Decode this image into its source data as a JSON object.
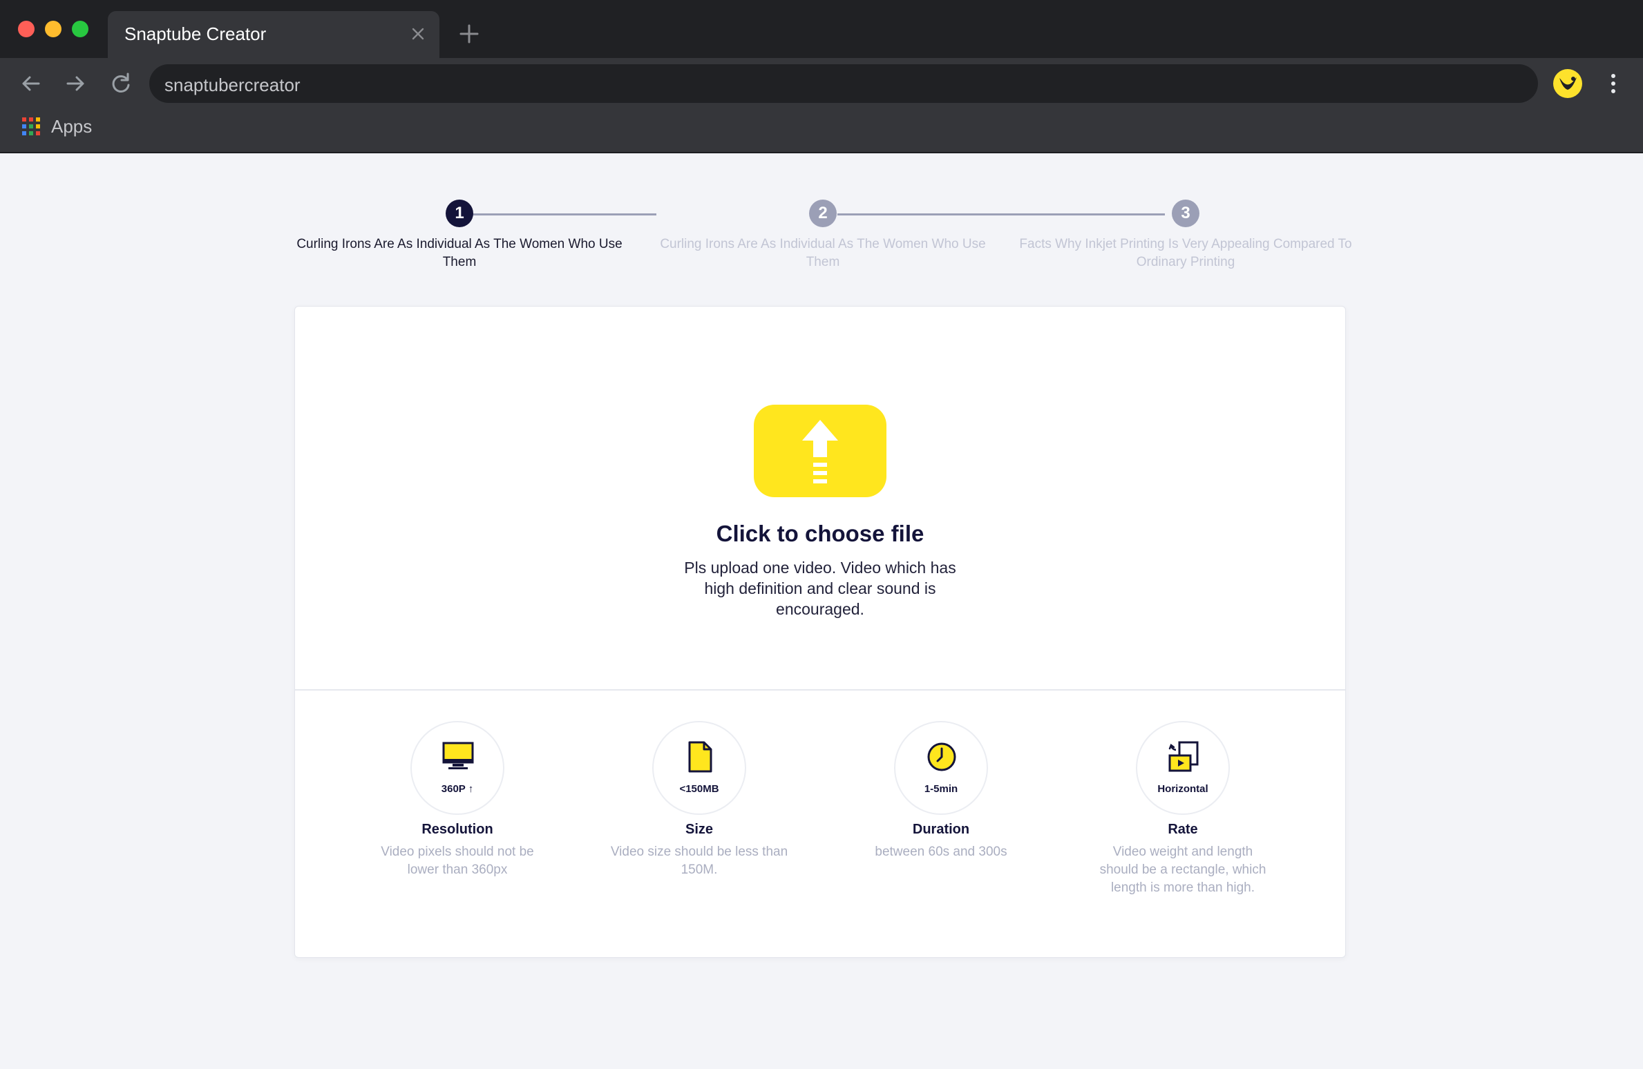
{
  "browser": {
    "tab_title": "Snaptube Creator",
    "address": "snaptubercreator",
    "bookmarks_apps": "Apps",
    "colors": {
      "frame": "#202124",
      "toolbar": "#35363a",
      "extension": "#fde22c"
    },
    "icons": [
      "close-icon",
      "plus-icon",
      "back-arrow-icon",
      "forward-arrow-icon",
      "reload-icon",
      "snaptube-extension-icon",
      "more-vert-icon",
      "apps-grid-icon"
    ]
  },
  "stepper": {
    "steps": [
      {
        "number": "1",
        "label": "Curling Irons Are As Individual As The Women Who Use Them",
        "state": "active"
      },
      {
        "number": "2",
        "label": "Curling Irons Are As Individual As The Women Who Use Them",
        "state": "inactive"
      },
      {
        "number": "3",
        "label": "Facts Why Inkjet Printing Is Very Appealing Compared To Ordinary Printing",
        "state": "inactive"
      }
    ]
  },
  "upload": {
    "icon": "upload-arrow-icon",
    "title": "Click to choose file",
    "description": "Pls upload one video. Video which has high definition and clear sound is encouraged.",
    "accent_color": "#ffe61e"
  },
  "requirements": [
    {
      "icon": "monitor-icon",
      "badge": "360P",
      "title": "Resolution",
      "description": "Video pixels should not be lower than 360px"
    },
    {
      "icon": "file-icon",
      "badge": "<150MB",
      "title": "Size",
      "description": "Video size should be less than 150M."
    },
    {
      "icon": "clock-icon",
      "badge": "1-5min",
      "title": "Duration",
      "description": "between 60s and 300s"
    },
    {
      "icon": "rotate-screen-icon",
      "badge": "Horizontal",
      "title": "Rate",
      "description": "Video weight and length should be a rectangle, which length is more than high."
    }
  ]
}
